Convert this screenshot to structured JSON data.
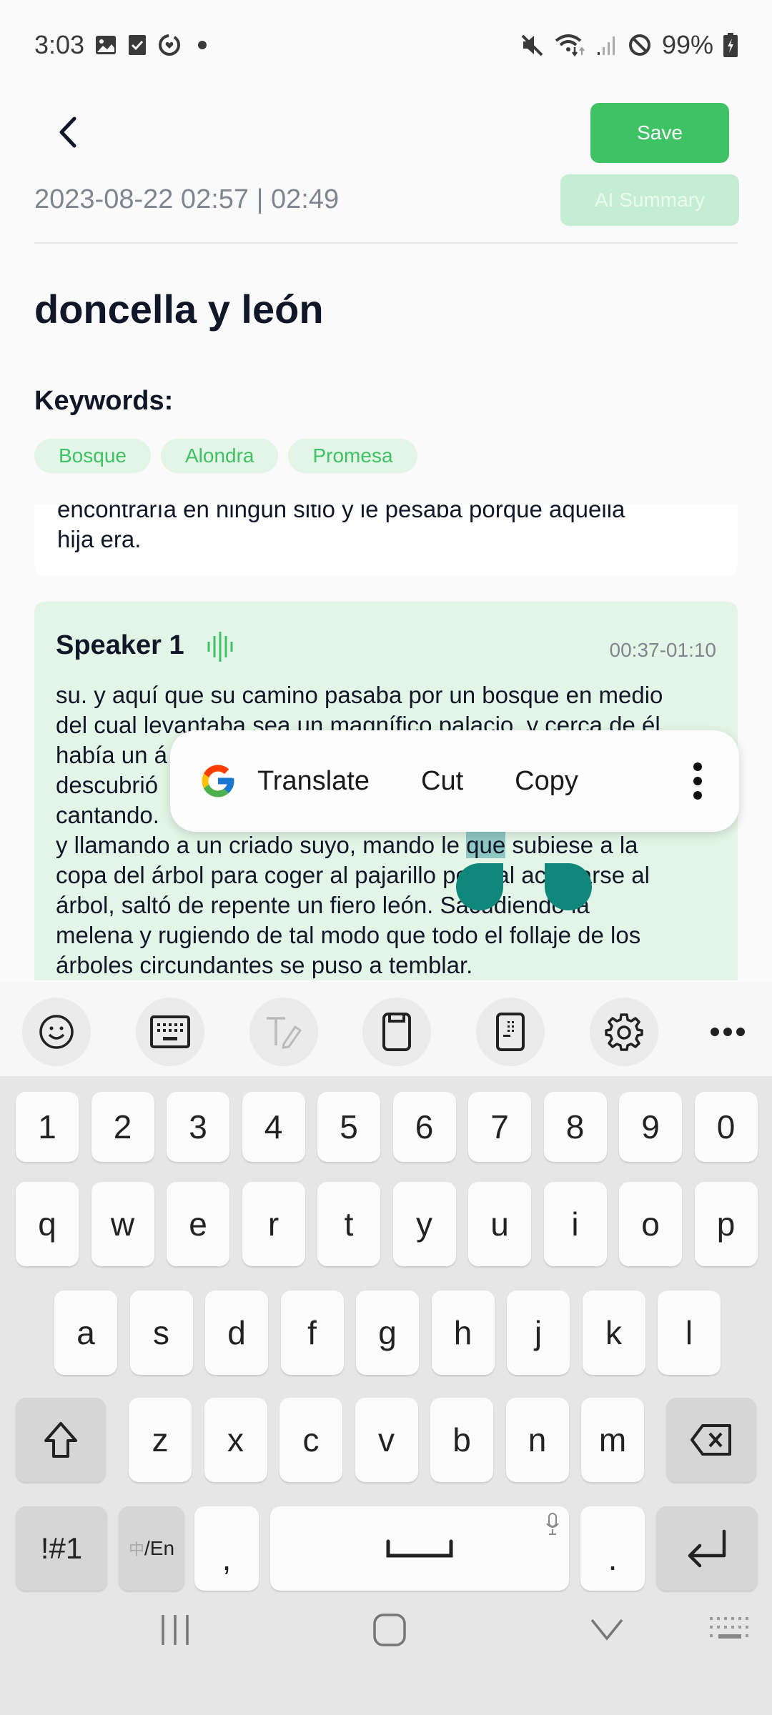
{
  "status_bar": {
    "time": "3:03",
    "left_icons": [
      "gallery-icon",
      "checkbox-icon",
      "health-ring-icon",
      "dot-icon"
    ],
    "right_icons": [
      "mute-icon",
      "wifi-icon",
      "signal-icon",
      "do-not-disturb-icon"
    ],
    "battery": "99%"
  },
  "header": {
    "back_icon": "chevron-left-icon",
    "save_label": "Save",
    "meta": "2023-08-22 02:57 | 02:49",
    "ai_summary_label": "AI Summary"
  },
  "document": {
    "title": "doncella y león",
    "keywords_label": "Keywords:",
    "keywords": [
      "Bosque",
      "Alondra",
      "Promesa"
    ]
  },
  "transcript": {
    "prev_segment_lines": [
      "encontraría en ningún sitio y le pesaba porque aquella",
      "hija era."
    ],
    "segment": {
      "speaker": "Speaker 1",
      "time_range": "00:37-01:10",
      "lines": [
        "su. y aquí que su camino pasaba por un bosque en medio",
        "del cual levantaba sea un magnífico palacio, y cerca de él",
        "había un á",
        "descubrió",
        "cantando.",
        "y llamando a un criado suyo, mando le ",
        "copa del árbol para coger al pajarillo pero al acercarse al",
        "árbol, saltó de repente un fiero león. Sacudiendo la",
        "melena y rugiendo de tal modo que todo el follaje de los",
        "árboles circundantes se puso a temblar."
      ],
      "selected_word": "que",
      "after_selection": " subiese a la"
    }
  },
  "selection_toolbar": {
    "translate_label": "Translate",
    "cut_label": "Cut",
    "copy_label": "Copy",
    "more_icon": "more-vertical-icon"
  },
  "keyboard_toolbar": {
    "items": [
      "emoji-icon",
      "keyboard-icon",
      "handwriting-icon",
      "clipboard-icon",
      "one-handed-keyboard-icon",
      "settings-icon",
      "more-horizontal-icon"
    ]
  },
  "keyboard": {
    "row_numbers": [
      "1",
      "2",
      "3",
      "4",
      "5",
      "6",
      "7",
      "8",
      "9",
      "0"
    ],
    "row1": [
      "q",
      "w",
      "e",
      "r",
      "t",
      "y",
      "u",
      "i",
      "o",
      "p"
    ],
    "row2": [
      "a",
      "s",
      "d",
      "f",
      "g",
      "h",
      "j",
      "k",
      "l"
    ],
    "row3": [
      "z",
      "x",
      "c",
      "v",
      "b",
      "n",
      "m"
    ],
    "symbols_label": "!#1",
    "lang_label_cn": "中",
    "lang_label_en": "/En",
    "comma": ",",
    "period": "."
  },
  "nav_bar": {
    "items": [
      "recent-apps-icon",
      "home-icon",
      "back-down-icon",
      "keyboard-switch-icon"
    ]
  }
}
